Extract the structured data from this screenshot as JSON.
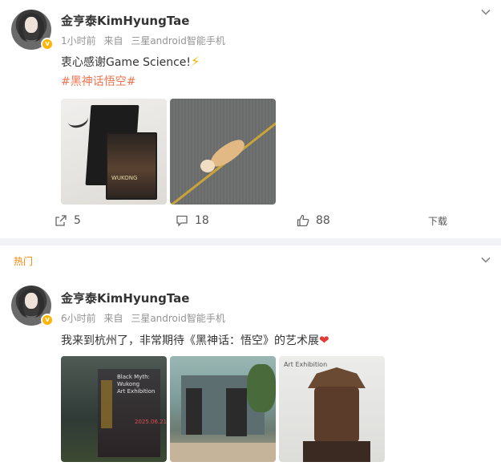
{
  "post1": {
    "author": "金亨泰KimHyungTae",
    "time": "1小时前",
    "source_prefix": "来自",
    "source": "三星android智能手机",
    "text": "衷心感谢Game Science!",
    "emoji_name": "lightning-icon",
    "topic": "#黑神话悟空#",
    "image_text": "WUKONG",
    "actions": {
      "repost_count": "5",
      "comment_count": "18",
      "like_count": "88",
      "download_label": "下载"
    }
  },
  "post2": {
    "hot_label": "热门",
    "author": "金亨泰KimHyungTae",
    "time": "6小时前",
    "source_prefix": "来自",
    "source": "三星android智能手机",
    "text": "我来到杭州了，非常期待《黑神话：悟空》的艺术展",
    "emoji_name": "heart-icon",
    "image1_text": "Black Myth:\nWukong\nArt Exhibition",
    "image1_date": "2025.06.21",
    "image3_text": "Art Exhibition"
  },
  "colors": {
    "topic": "#eb7350",
    "hot": "#ff8200",
    "meta": "#939393",
    "badge": "#ffb400",
    "heart": "#e53935"
  }
}
